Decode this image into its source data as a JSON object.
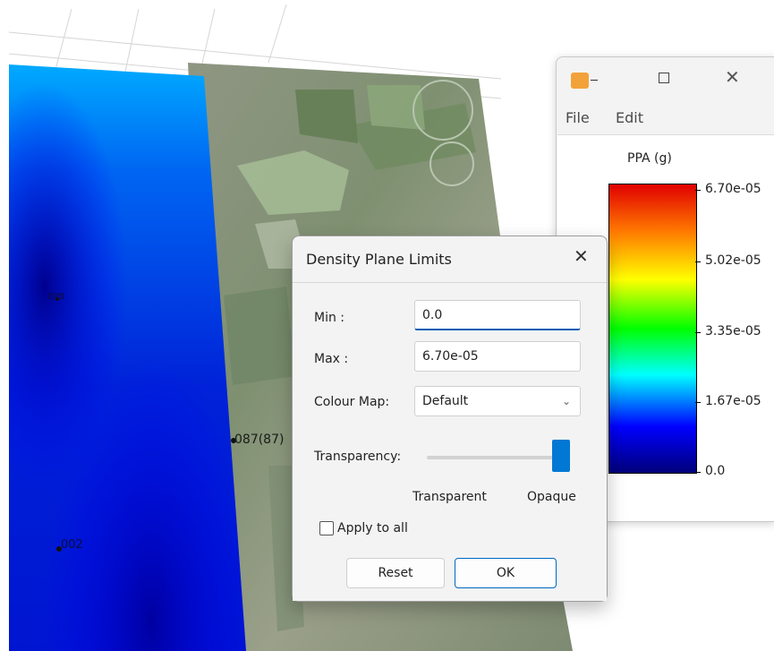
{
  "map": {
    "points": [
      "008",
      "087(87)",
      "002"
    ]
  },
  "color_bar_window": {
    "menu": [
      "File",
      "Edit"
    ],
    "legend_title": "PPA (g)",
    "ticks": [
      "6.70e-05",
      "5.02e-05",
      "3.35e-05",
      "1.67e-05",
      "0.0"
    ],
    "close_glyph": "✕",
    "icon": "app-icon"
  },
  "dialog": {
    "title": "Density Plane Limits",
    "close_glyph": "✕",
    "min_label": "Min :",
    "min_value": "0.0",
    "max_label": "Max :",
    "max_value": "6.70e-05",
    "colour_map_label": "Colour Map:",
    "colour_map_value": "Default",
    "chevron_glyph": "⌄",
    "transparency_label": "Transparency:",
    "transparency_level": 1.0,
    "slider_min_label": "Transparent",
    "slider_max_label": "Opaque",
    "apply_to_all_label": "Apply to all",
    "reset_label": "Reset",
    "ok_label": "OK"
  },
  "colors": {
    "accent": "#0078d4",
    "plane_blue": "#0022d8",
    "plane_cyan": "#00aaff"
  }
}
